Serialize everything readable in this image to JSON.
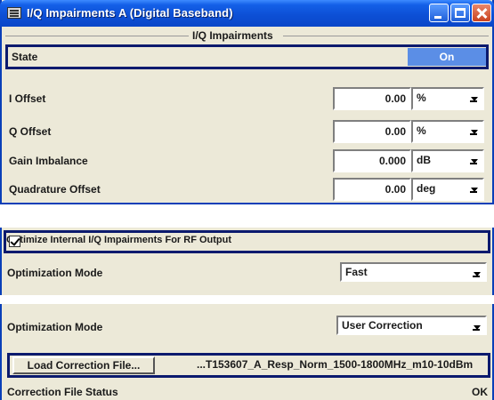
{
  "window": {
    "title": "I/Q Impairments A (Digital Baseband)",
    "group_title": "I/Q Impairments"
  },
  "state": {
    "label": "State",
    "button": "On"
  },
  "params": [
    {
      "label": "I Offset",
      "value": "0.00",
      "unit": "%"
    },
    {
      "label": "Q Offset",
      "value": "0.00",
      "unit": "%"
    },
    {
      "label": "Gain Imbalance",
      "value": "0.000",
      "unit": "dB"
    },
    {
      "label": "Quadrature Offset",
      "value": "0.00",
      "unit": "deg"
    }
  ],
  "optimize": {
    "checkbox_label": "Optimize Internal I/Q Impairments For RF Output",
    "checked": true,
    "mode_label": "Optimization Mode",
    "mode_value": "Fast"
  },
  "correction": {
    "mode_label": "Optimization Mode",
    "mode_value": "User Correction",
    "load_button": "Load Correction File...",
    "file_name": "...T153607_A_Resp_Norm_1500-1800MHz_m10-10dBm",
    "status_label": "Correction File Status",
    "status_value": "OK"
  },
  "colors": {
    "title_bar": "#0a46c8",
    "on_button": "#5b8ee6",
    "highlight_border": "#0b1a6e",
    "panel_bg": "#ece9d8"
  }
}
